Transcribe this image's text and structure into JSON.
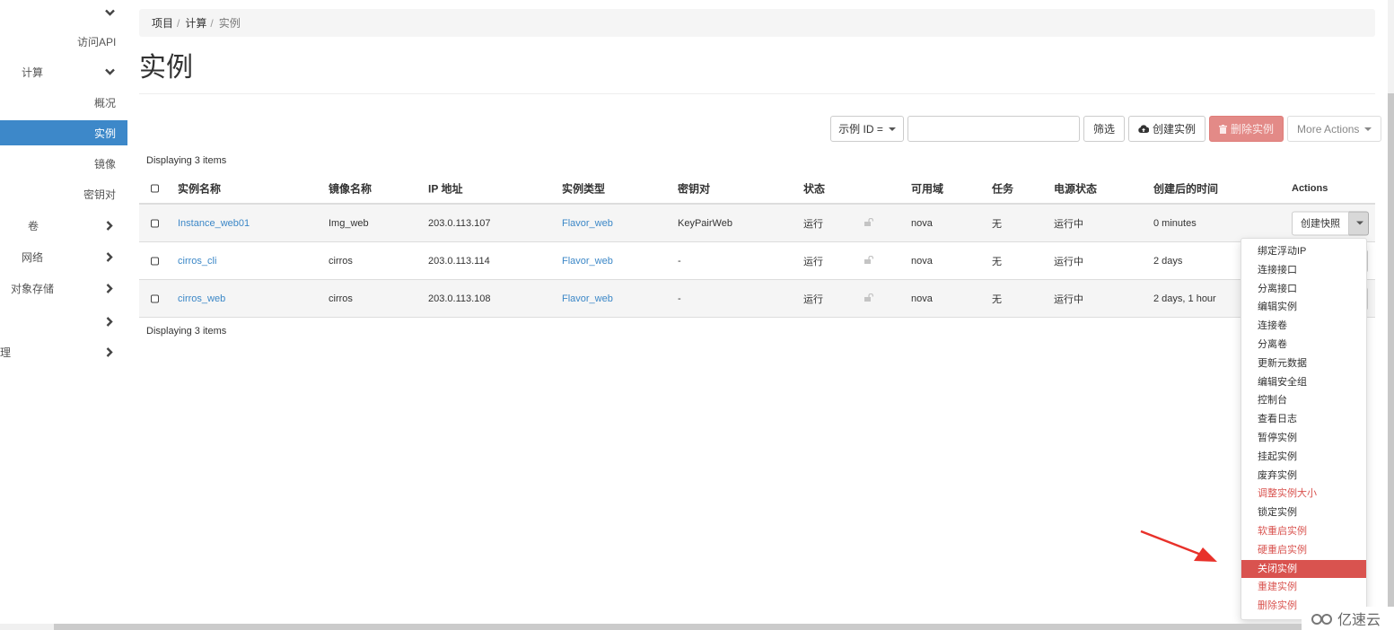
{
  "sidebar": {
    "items": [
      {
        "label": "",
        "chevron": "down"
      },
      {
        "label": "访问API",
        "chevron": ""
      },
      {
        "label": "计算",
        "chevron": "down"
      },
      {
        "label": "概况",
        "chevron": ""
      },
      {
        "label": "实例",
        "chevron": "",
        "active": true
      },
      {
        "label": "镜像",
        "chevron": ""
      },
      {
        "label": "密钥对",
        "chevron": ""
      },
      {
        "label": "卷",
        "chevron": "right"
      },
      {
        "label": "网络",
        "chevron": "right"
      },
      {
        "label": "对象存储",
        "chevron": "right"
      },
      {
        "label": "",
        "chevron": "right"
      },
      {
        "label": "理",
        "chevron": "right"
      }
    ]
  },
  "breadcrumb": {
    "items": [
      "项目",
      "计算",
      "实例"
    ],
    "separator": "/"
  },
  "page": {
    "title": "实例"
  },
  "toolbar": {
    "filter_field": "示例 ID =",
    "filter_value": "",
    "filter_button": "筛选",
    "create_button": "创建实例",
    "delete_button": "删除实例",
    "more_actions": "More Actions"
  },
  "table": {
    "displaying_top": "Displaying 3 items",
    "displaying_bottom": "Displaying 3 items",
    "columns": [
      "实例名称",
      "镜像名称",
      "IP 地址",
      "实例类型",
      "密钥对",
      "状态",
      "",
      "可用域",
      "任务",
      "电源状态",
      "创建后的时间",
      "Actions"
    ],
    "rows": [
      {
        "name": "Instance_web01",
        "image": "Img_web",
        "ip": "203.0.113.107",
        "flavor": "Flavor_web",
        "keypair": "KeyPairWeb",
        "status": "运行",
        "az": "nova",
        "task": "无",
        "power": "运行中",
        "age": "0 minutes",
        "action": "创建快照"
      },
      {
        "name": "cirros_cli",
        "image": "cirros",
        "ip": "203.0.113.114",
        "flavor": "Flavor_web",
        "keypair": "-",
        "status": "运行",
        "az": "nova",
        "task": "无",
        "power": "运行中",
        "age": "2 days",
        "action": ""
      },
      {
        "name": "cirros_web",
        "image": "cirros",
        "ip": "203.0.113.108",
        "flavor": "Flavor_web",
        "keypair": "-",
        "status": "运行",
        "az": "nova",
        "task": "无",
        "power": "运行中",
        "age": "2 days, 1 hour",
        "action": ""
      }
    ]
  },
  "dropdown": {
    "items": [
      {
        "label": "绑定浮动IP",
        "style": "normal"
      },
      {
        "label": "连接接口",
        "style": "normal"
      },
      {
        "label": "分离接口",
        "style": "normal"
      },
      {
        "label": "编辑实例",
        "style": "normal"
      },
      {
        "label": "连接卷",
        "style": "normal"
      },
      {
        "label": "分离卷",
        "style": "normal"
      },
      {
        "label": "更新元数据",
        "style": "normal"
      },
      {
        "label": "编辑安全组",
        "style": "normal"
      },
      {
        "label": "控制台",
        "style": "normal"
      },
      {
        "label": "查看日志",
        "style": "normal"
      },
      {
        "label": "暂停实例",
        "style": "normal"
      },
      {
        "label": "挂起实例",
        "style": "normal"
      },
      {
        "label": "废弃实例",
        "style": "normal"
      },
      {
        "label": "调整实例大小",
        "style": "danger"
      },
      {
        "label": "锁定实例",
        "style": "normal"
      },
      {
        "label": "软重启实例",
        "style": "danger"
      },
      {
        "label": "硬重启实例",
        "style": "danger"
      },
      {
        "label": "关闭实例",
        "style": "active"
      },
      {
        "label": "重建实例",
        "style": "danger"
      },
      {
        "label": "删除实例",
        "style": "danger"
      }
    ]
  },
  "colors": {
    "primary": "#3d88c9",
    "link": "#3b87c7",
    "danger": "#d9534f",
    "danger_button": "#e38a87",
    "annotation_arrow": "#e8312a"
  },
  "watermark": {
    "text": "亿速云"
  }
}
